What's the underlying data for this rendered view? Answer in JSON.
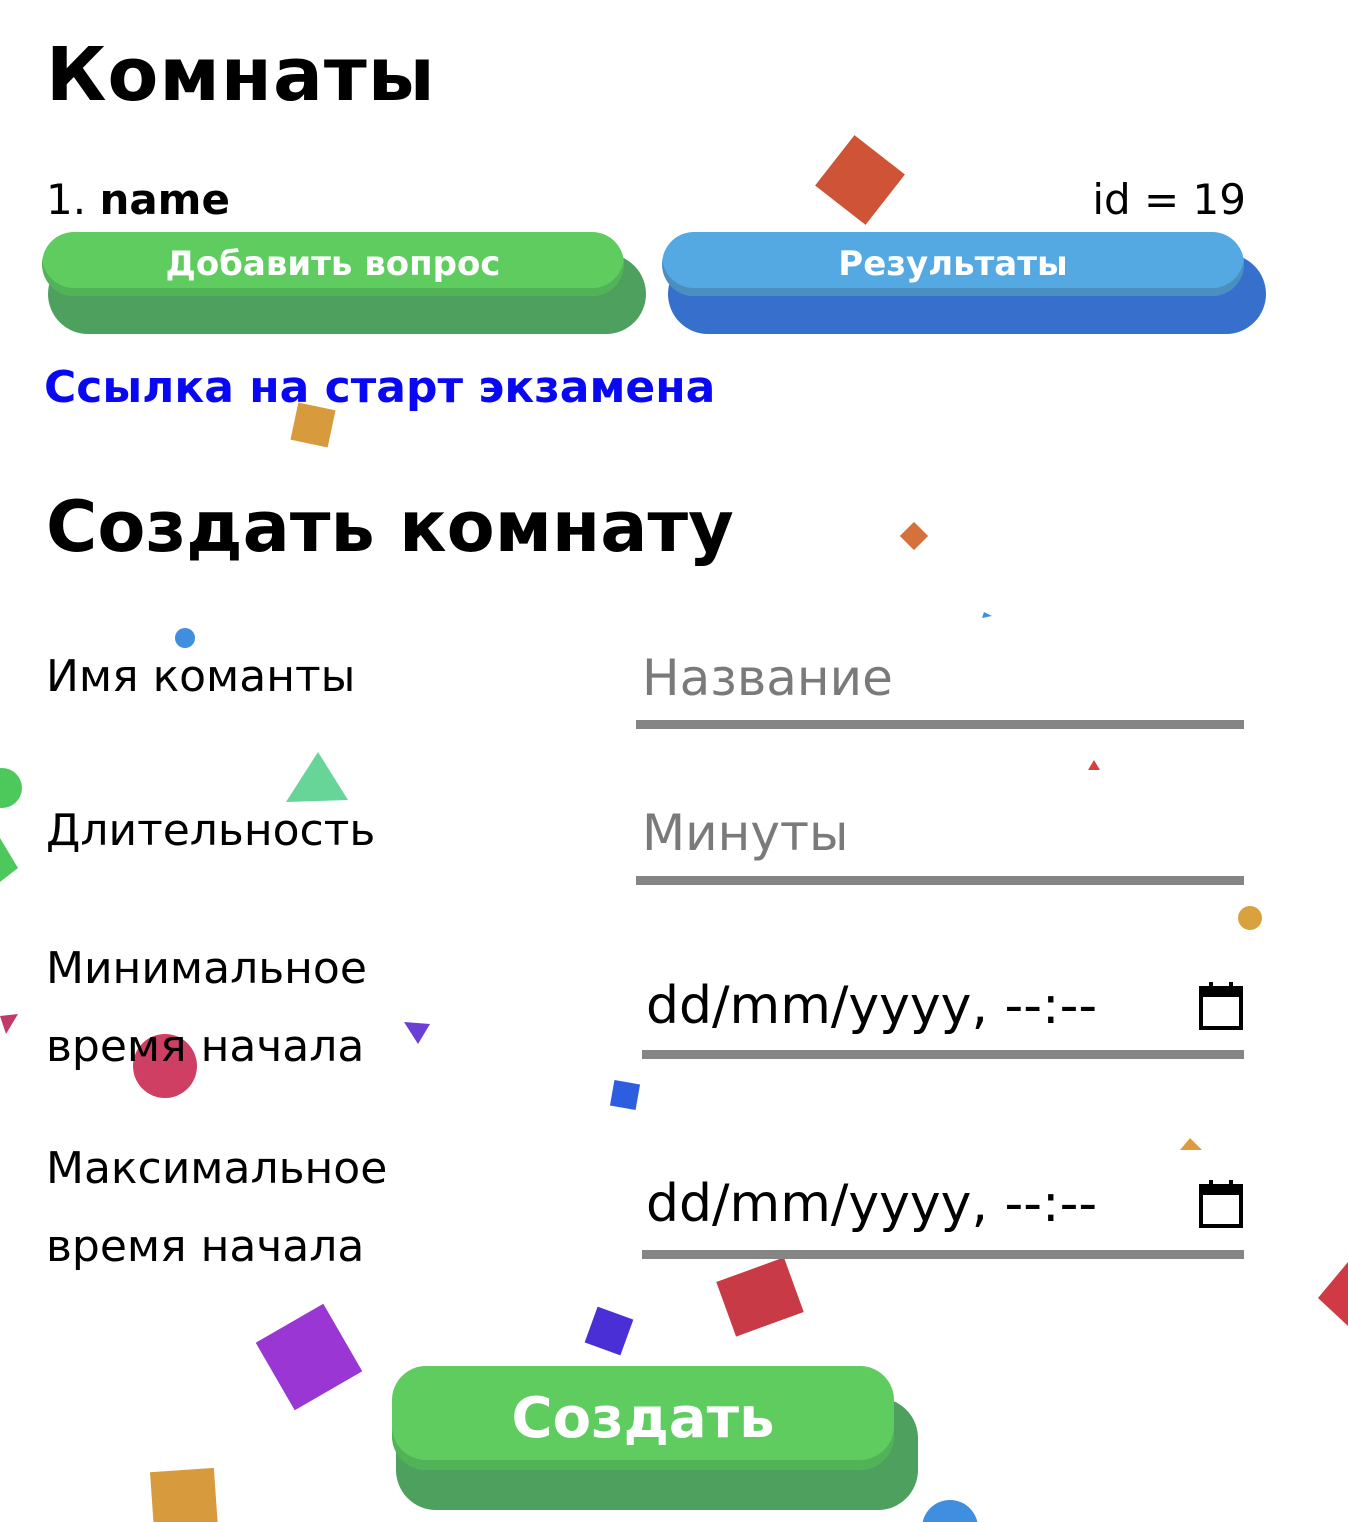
{
  "rooms": {
    "title": "Комнаты",
    "items": [
      {
        "number": "1.",
        "name": "name",
        "id_text": "id = 19",
        "add_question_label": "Добавить вопрос",
        "results_label": "Результаты"
      }
    ],
    "exam_link_label": "Ссылка на старт экзамена"
  },
  "create_room": {
    "title": "Создать комнату",
    "fields": {
      "name": {
        "label": "Имя команты",
        "placeholder": "Название",
        "value": ""
      },
      "duration": {
        "label": "Длительность",
        "placeholder": "Минуты",
        "value": ""
      },
      "min_start": {
        "label_line1": "Минимальное",
        "label_line2": "время начала",
        "value": "dd/mm/yyyy, --:--"
      },
      "max_start": {
        "label_line1": "Максимальное",
        "label_line2": "время начала",
        "value": "dd/mm/yyyy, --:--"
      }
    },
    "submit_label": "Создать"
  },
  "colors": {
    "green_button": "#5fcc60",
    "blue_button": "#54a9e3",
    "link": "#0808f2",
    "underline": "#858585"
  },
  "icons": {
    "date_picker": "calendar-icon"
  }
}
